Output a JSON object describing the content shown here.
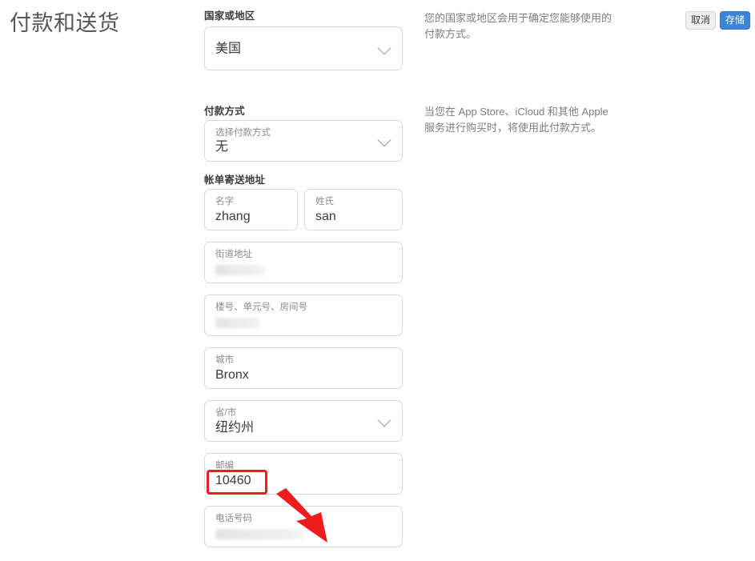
{
  "page": {
    "title": "付款和送货"
  },
  "toolbar": {
    "cancel_label": "取消",
    "save_label": "存储",
    "save_color": "#3b84d6",
    "cancel_color": "#f0f0f0"
  },
  "sections": {
    "country": {
      "heading": "国家或地区",
      "value": "美国",
      "help": "您的国家或地区会用于确定您能够使用的付款方式。"
    },
    "payment": {
      "heading": "付款方式",
      "label": "选择付款方式",
      "value": "无",
      "help": "当您在 App Store、iCloud 和其他 Apple 服务进行购买时，将使用此付款方式。"
    },
    "billing": {
      "heading": "帐单寄送地址",
      "fields": [
        {
          "label": "名字",
          "value": "zhang",
          "redacted": false
        },
        {
          "label": "姓氏",
          "value": "san",
          "redacted": false
        },
        {
          "label": "街道地址",
          "value": "",
          "redacted": true
        },
        {
          "label": "楼号、单元号、房间号",
          "value": "",
          "redacted": true
        },
        {
          "label": "城市",
          "value": "Bronx",
          "redacted": false
        },
        {
          "label": "省/市",
          "value": "纽约州",
          "redacted": false
        },
        {
          "label": "邮编",
          "value": "10460",
          "redacted": false
        },
        {
          "label": "电话号码",
          "value": "",
          "redacted": true
        }
      ]
    }
  },
  "annotation": {
    "highlight_color": "#ee1c1c",
    "highlighted_value": "10460"
  }
}
